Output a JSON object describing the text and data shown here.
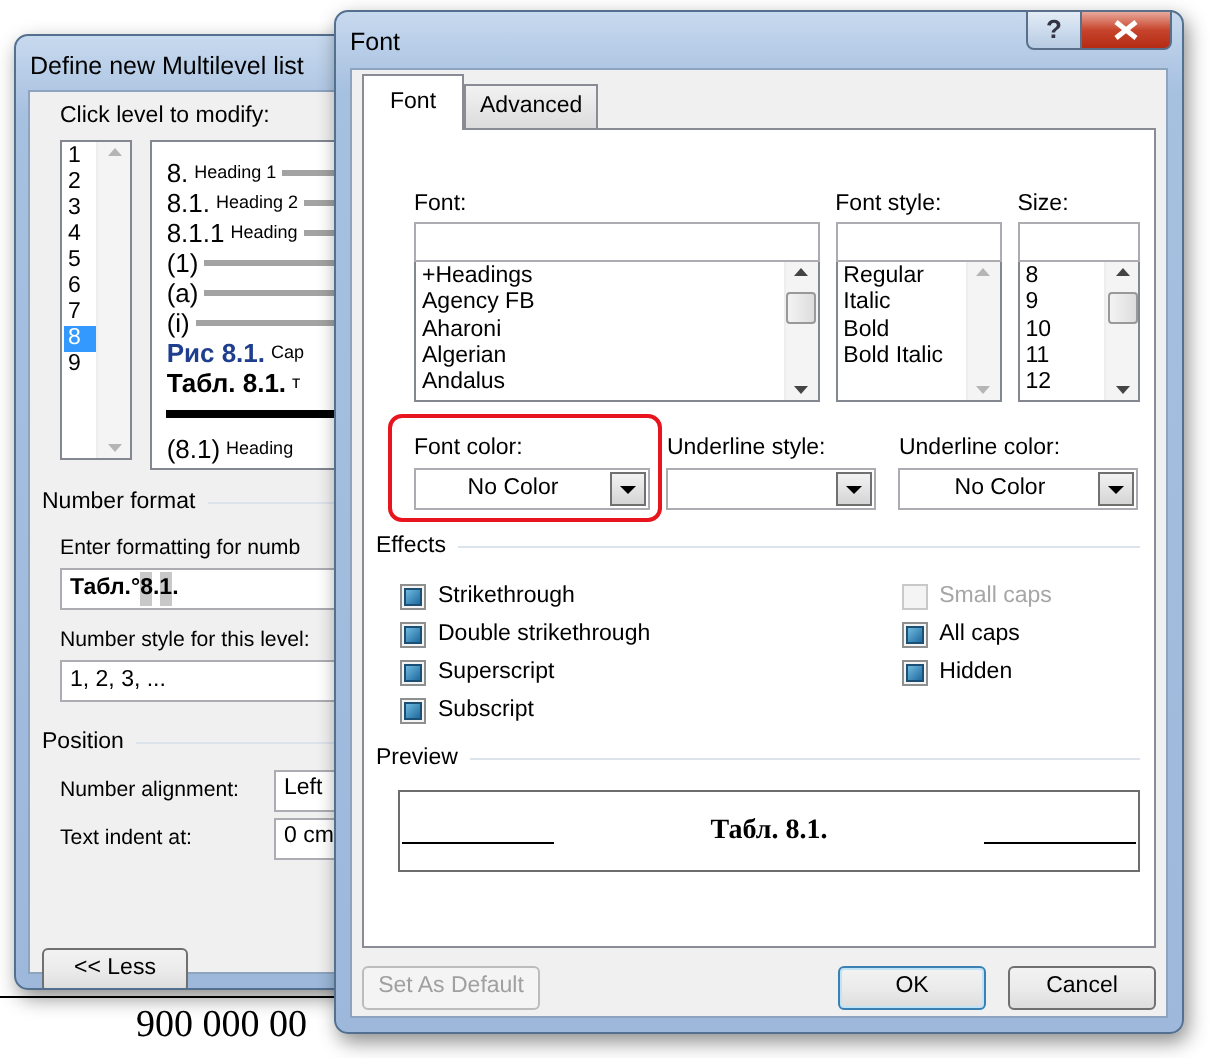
{
  "document": {
    "text": "900 000 00"
  },
  "multilevel_dialog": {
    "title": "Define new Multilevel list",
    "level_label": "Click level to modify:",
    "levels": [
      {
        "label": "1",
        "selected": false
      },
      {
        "label": "2",
        "selected": false
      },
      {
        "label": "3",
        "selected": false
      },
      {
        "label": "4",
        "selected": false
      },
      {
        "label": "5",
        "selected": false
      },
      {
        "label": "6",
        "selected": false
      },
      {
        "label": "7",
        "selected": false
      },
      {
        "label": "8",
        "selected": true
      },
      {
        "label": "9",
        "selected": false
      }
    ],
    "preview_rows": [
      {
        "kind": "line",
        "number": "8.",
        "heading": "Heading 1"
      },
      {
        "kind": "line",
        "number": "8.1.",
        "heading": "Heading 2"
      },
      {
        "kind": "line",
        "number": "8.1.1",
        "heading": "Heading"
      },
      {
        "kind": "line",
        "number": "(1)"
      },
      {
        "kind": "line",
        "number": "(a)"
      },
      {
        "kind": "line",
        "number": "(i)"
      },
      {
        "kind": "blue",
        "number": "Рис 8.1.",
        "heading": "Cap"
      },
      {
        "kind": "bold",
        "number": "Табл. 8.1.",
        "heading": "т"
      },
      {
        "kind": "rule"
      },
      {
        "kind": "plain",
        "number": "(8.1)",
        "heading": "Heading"
      }
    ],
    "number_format": {
      "heading": "Number format",
      "format_label": "Enter formatting for numb",
      "format_value": [
        {
          "text": "Табл.°",
          "field": false
        },
        {
          "text": "8",
          "field": true
        },
        {
          "text": ".",
          "field": false
        },
        {
          "text": "1",
          "field": true
        },
        {
          "text": ".",
          "field": false
        }
      ],
      "style_label": "Number style for this level:",
      "style_value": "1, 2, 3, ..."
    },
    "position": {
      "heading": "Position",
      "alignment_label": "Number alignment:",
      "alignment_value": "Left",
      "indent_label": "Text indent at:",
      "indent_value": "0 cm"
    },
    "less_button": "<< Less"
  },
  "font_dialog": {
    "title": "Font",
    "help_button": "?",
    "tabs": [
      {
        "label": "Font",
        "selected": true
      },
      {
        "label": "Advanced",
        "selected": false
      }
    ],
    "lists": [
      {
        "label": "Font:",
        "scrollable": true,
        "items": [
          "+Headings",
          "Agency FB",
          "Aharoni",
          "Algerian",
          "Andalus"
        ]
      },
      {
        "label": "Font style:",
        "scrollable": false,
        "items": [
          "Regular",
          "Italic",
          "Bold",
          "Bold Italic"
        ]
      },
      {
        "label": "Size:",
        "scrollable": true,
        "items": [
          "8",
          "9",
          "10",
          "11",
          "12"
        ]
      }
    ],
    "dropdowns": [
      {
        "label": "Font color:",
        "value": "No Color",
        "highlighted": true
      },
      {
        "label": "Underline style:",
        "highlighted": false
      },
      {
        "label": "Underline color:",
        "value": "No Color",
        "highlighted": false
      }
    ],
    "effects_heading": "Effects",
    "effects_left": [
      {
        "label": "Strikethrough",
        "indeterminate": true,
        "disabled": false
      },
      {
        "label": "Double strikethrough",
        "indeterminate": true,
        "disabled": false
      },
      {
        "label": "Superscript",
        "indeterminate": true,
        "disabled": false
      },
      {
        "label": "Subscript",
        "indeterminate": true,
        "disabled": false
      }
    ],
    "effects_right": [
      {
        "label": "Small caps",
        "indeterminate": false,
        "disabled": true
      },
      {
        "label": "All caps",
        "indeterminate": true,
        "disabled": false
      },
      {
        "label": "Hidden",
        "indeterminate": true,
        "disabled": false
      }
    ],
    "preview_heading": "Preview",
    "preview_text": "Табл. 8.1.",
    "buttons": [
      {
        "label": "Set As Default",
        "disabled": true,
        "default": false
      },
      {
        "label": "OK",
        "disabled": false,
        "default": true
      },
      {
        "label": "Cancel",
        "disabled": false,
        "default": false
      }
    ]
  }
}
